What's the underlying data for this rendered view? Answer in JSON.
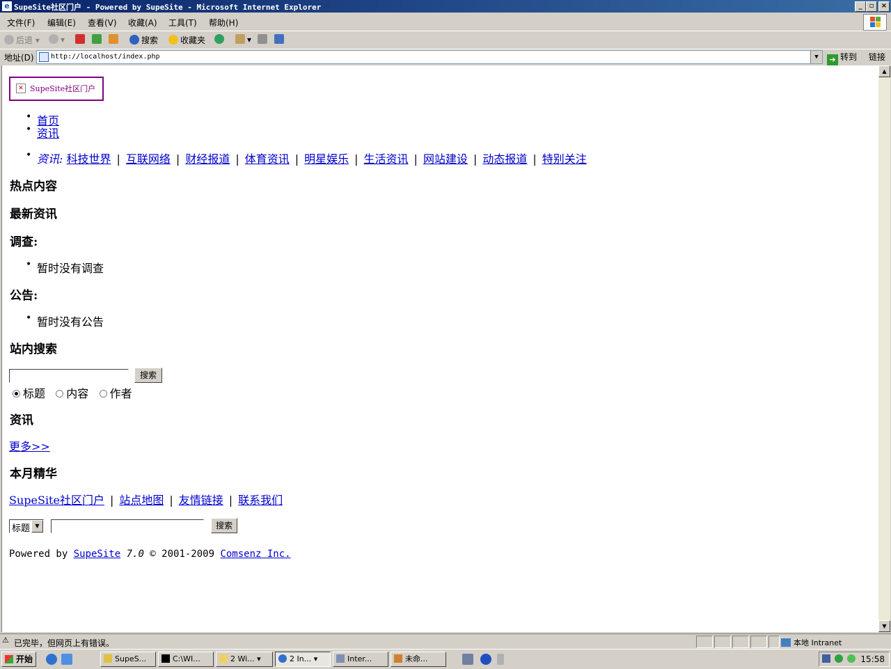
{
  "window": {
    "title": "SupeSite社区门户 - Powered by SupeSite - Microsoft Internet Explorer",
    "min_label": "_",
    "max_label": "▫",
    "close_label": "×"
  },
  "menu": [
    "文件(F)",
    "编辑(E)",
    "查看(V)",
    "收藏(A)",
    "工具(T)",
    "帮助(H)"
  ],
  "toolbar": {
    "back": "后退",
    "search": "搜索",
    "favorites": "收藏夹"
  },
  "address": {
    "label": "地址(D)",
    "url": "http://localhost/index.php",
    "go": "转到",
    "links": "链接"
  },
  "page": {
    "logo_alt": "SupeSite社区门户",
    "nav": [
      "首页",
      "资讯"
    ],
    "category_label": "资讯:",
    "categories": [
      "科技世界",
      "互联网络",
      "财经报道",
      "体育资讯",
      "明星娱乐",
      "生活资讯",
      "网站建设",
      "动态报道",
      "特别关注"
    ],
    "sections": {
      "hot": "热点内容",
      "latest": "最新资讯",
      "poll": "调查:",
      "poll_empty": "暂时没有调查",
      "notice": "公告:",
      "notice_empty": "暂时没有公告",
      "site_search": "站内搜索",
      "news": "资讯",
      "more": "更多>>",
      "monthly": "本月精华"
    },
    "search": {
      "button": "搜索",
      "radios": [
        "标题",
        "内容",
        "作者"
      ],
      "selected": "标题"
    },
    "footer_links": [
      "SupeSite社区门户",
      "站点地图",
      "友情链接",
      "联系我们"
    ],
    "footer_search": {
      "select_value": "标题",
      "button": "搜索"
    },
    "powered": {
      "prefix": "Powered by ",
      "product": "SupeSite",
      "version": " 7.0",
      "copyright": " © 2001-2009 ",
      "company": "Comsenz Inc."
    }
  },
  "status": {
    "text": "已完毕，但网页上有错误。",
    "zone": "本地 Intranet"
  },
  "taskbar": {
    "start": "开始",
    "tasks": [
      "SupeS...",
      "C:\\WI...",
      "2 Wi...",
      "2 In...",
      "Inter...",
      "未命..."
    ],
    "clock": "15:58"
  }
}
